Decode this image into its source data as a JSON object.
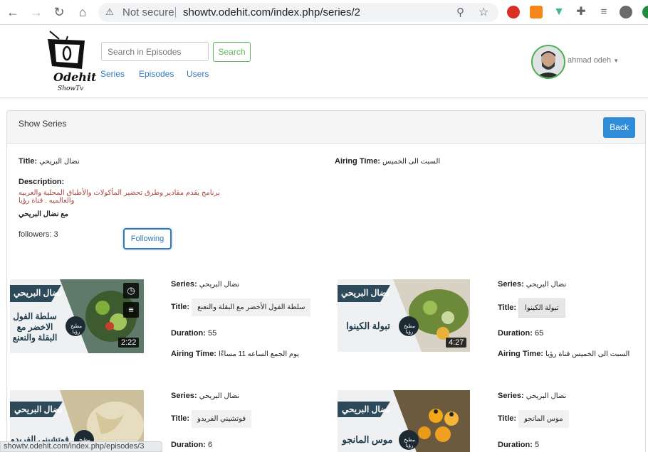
{
  "browser": {
    "security_label": "Not secure",
    "url": "showtv.odehit.com/index.php/series/2"
  },
  "header": {
    "logo_text": "Odehit",
    "logo_sub": "ShowTv",
    "search_placeholder": "Search in Episodes",
    "search_button": "Search",
    "nav": [
      "Series",
      "Episodes",
      "Users"
    ],
    "user_name": "ahmad odeh"
  },
  "panel": {
    "title": "Show Series",
    "back_label": "Back",
    "title_label": "Title:",
    "title_value": "نضال البريحي",
    "airing_label": "Airing Time:",
    "airing_value": "السبت الى الخميس",
    "description_label": "Description:",
    "description_value": "برنامج يقدم مقادير وطرق تحضير المأكولات والأطباق المحلية والعربيه والعالميه . قناة رؤيا",
    "host_value": "مع نضال البريحي",
    "followers_text": "followers: 3",
    "follow_button": "Following"
  },
  "episodes": [
    {
      "series_label": "Series:",
      "series": "نضال البريحي",
      "title_label": "Title:",
      "title": "سلطة الفول الأخضر مع البقلة والنعنع",
      "duration_label": "Duration:",
      "duration": "55",
      "airing_label": "Airing Time:",
      "airing": "يوم الجمع الساعه 11 مساءًا",
      "thumb_title": "سلطة الفول الاخضر مع البقلة والنعنع",
      "thumb_time": "2:22",
      "thumb_name": "نضال البريحي",
      "thumb_logo": "مطبخ رؤيا"
    },
    {
      "series_label": "Series:",
      "series": "نضال البريحي",
      "title_label": "Title:",
      "title": "تبولة الكينوا",
      "duration_label": "Duration:",
      "duration": "65",
      "airing_label": "Airing Time:",
      "airing": "السبت الى الخميس قناة رؤيا",
      "thumb_title": "تبولة الكينوا",
      "thumb_time": "4:27",
      "thumb_name": "نضال البريحي",
      "thumb_logo": "مطبخ رؤيا"
    },
    {
      "series_label": "Series:",
      "series": "نضال البريحي",
      "title_label": "Title:",
      "title": "فوتشيني الفريدو",
      "duration_label": "Duration:",
      "duration": "6",
      "thumb_title": "فوتشيني الفريدو",
      "thumb_name": "نضال البريحي",
      "thumb_logo": "مطبخ رؤيا"
    },
    {
      "series_label": "Series:",
      "series": "نضال البريحي",
      "title_label": "Title:",
      "title": "موس المانجو",
      "duration_label": "Duration:",
      "duration": "5",
      "thumb_title": "موس المانجو",
      "thumb_name": "نضال البريحي",
      "thumb_logo": "مطبخ رؤيا"
    }
  ],
  "status_url": "showtv.odehit.com/index.php/episodes/3",
  "colors": {
    "link": "#337ab7",
    "success": "#5cb85c",
    "danger": "#a94442",
    "primary_btn": "#2f8cd8"
  }
}
